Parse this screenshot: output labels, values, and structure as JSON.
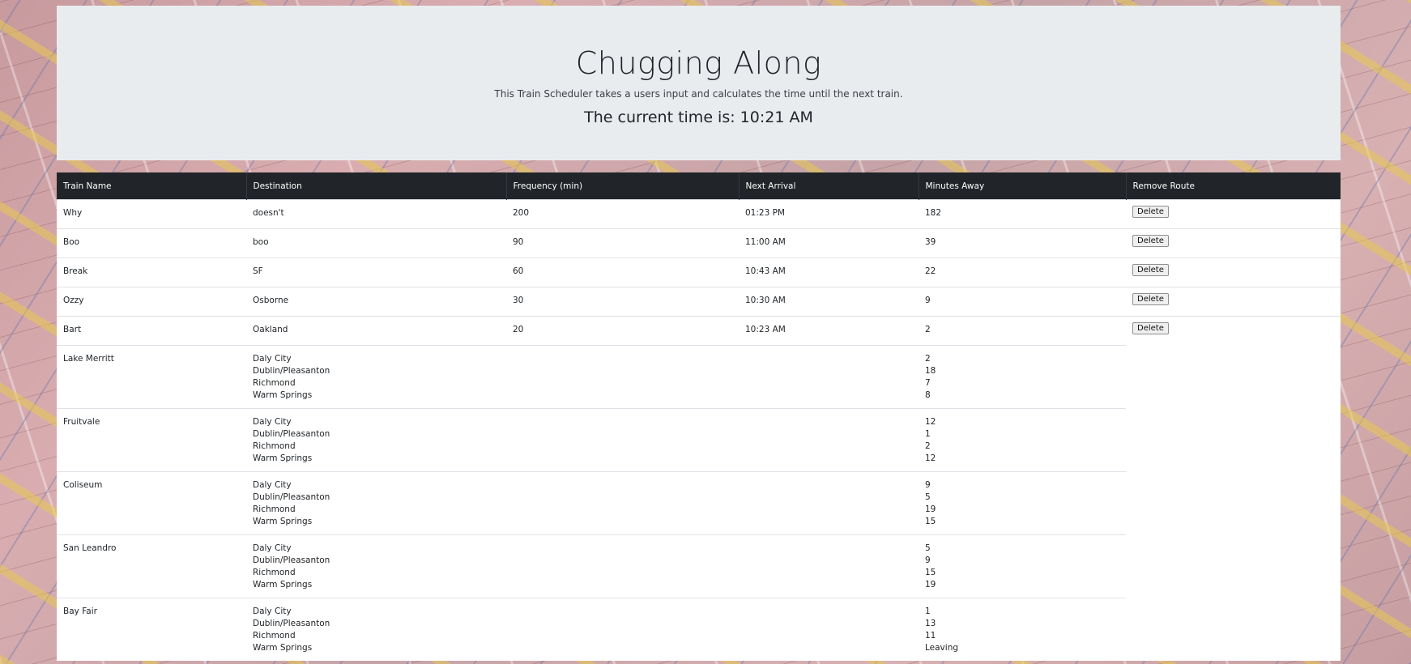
{
  "header": {
    "title": "Chugging Along",
    "subtitle": "This Train Scheduler takes a users input and calculates the time until the next train.",
    "current_time_label": "The current time is: 10:21 AM"
  },
  "table": {
    "columns": [
      "Train Name",
      "Destination",
      "Frequency (min)",
      "Next Arrival",
      "Minutes Away",
      "Remove Route"
    ],
    "delete_label": "Delete",
    "routes": [
      {
        "name": "Why",
        "destination": "doesn't",
        "frequency": "200",
        "next_arrival": "01:23 PM",
        "minutes_away": "182"
      },
      {
        "name": "Boo",
        "destination": "boo",
        "frequency": "90",
        "next_arrival": "11:00 AM",
        "minutes_away": "39"
      },
      {
        "name": "Break",
        "destination": "SF",
        "frequency": "60",
        "next_arrival": "10:43 AM",
        "minutes_away": "22"
      },
      {
        "name": "Ozzy",
        "destination": "Osborne",
        "frequency": "30",
        "next_arrival": "10:30 AM",
        "minutes_away": "9"
      },
      {
        "name": "Bart",
        "destination": "Oakland",
        "frequency": "20",
        "next_arrival": "10:23 AM",
        "minutes_away": "2"
      }
    ],
    "stations": [
      {
        "name": "Lake Merritt",
        "destinations": [
          "Daly City",
          "Dublin/Pleasanton",
          "Richmond",
          "Warm Springs"
        ],
        "minutes": [
          "2",
          "18",
          "7",
          "8"
        ]
      },
      {
        "name": "Fruitvale",
        "destinations": [
          "Daly City",
          "Dublin/Pleasanton",
          "Richmond",
          "Warm Springs"
        ],
        "minutes": [
          "12",
          "1",
          "2",
          "12"
        ]
      },
      {
        "name": "Coliseum",
        "destinations": [
          "Daly City",
          "Dublin/Pleasanton",
          "Richmond",
          "Warm Springs"
        ],
        "minutes": [
          "9",
          "5",
          "19",
          "15"
        ]
      },
      {
        "name": "San Leandro",
        "destinations": [
          "Daly City",
          "Dublin/Pleasanton",
          "Richmond",
          "Warm Springs"
        ],
        "minutes": [
          "5",
          "9",
          "15",
          "19"
        ]
      },
      {
        "name": "Bay Fair",
        "destinations": [
          "Daly City",
          "Dublin/Pleasanton",
          "Richmond",
          "Warm Springs"
        ],
        "minutes": [
          "1",
          "13",
          "11",
          "Leaving"
        ]
      }
    ]
  }
}
